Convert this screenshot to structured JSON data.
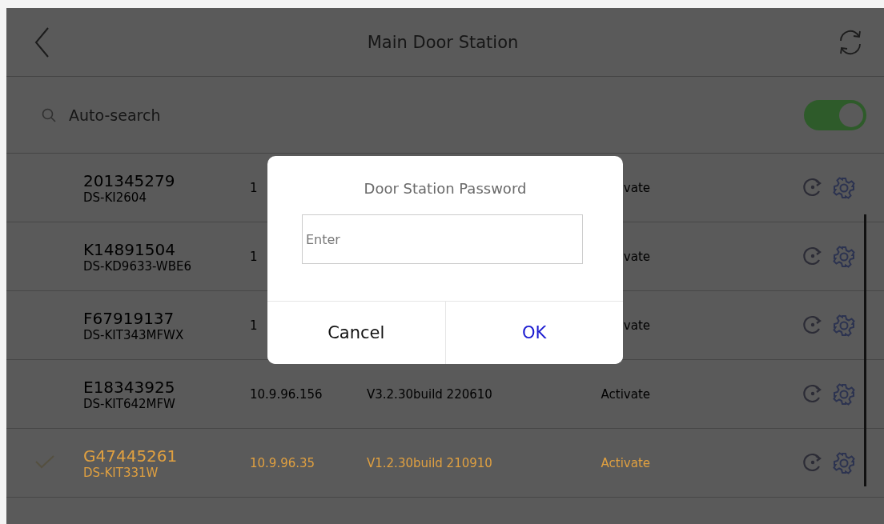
{
  "header": {
    "title": "Main Door Station"
  },
  "auto_search": {
    "label": "Auto-search",
    "on": true
  },
  "devices": [
    {
      "serial": "201345279",
      "model": "DS-KI2604",
      "ip": "1",
      "status": "vate",
      "selected": false
    },
    {
      "serial": "K14891504",
      "model": "DS-KD9633-WBE6",
      "ip": "1",
      "status": "vate",
      "selected": false
    },
    {
      "serial": "F67919137",
      "model": "DS-KIT343MFWX",
      "ip": "1",
      "status": "vate",
      "selected": false
    },
    {
      "serial": "E18343925",
      "model": "DS-KIT642MFW",
      "ip": "10.9.96.156",
      "firmware": "V3.2.30build 220610",
      "status": "Activate",
      "selected": false
    },
    {
      "serial": "G47445261",
      "model": "DS-KIT331W",
      "ip": "10.9.96.35",
      "firmware": "V1.2.30build 210910",
      "status": "Activate",
      "selected": true
    }
  ],
  "dialog": {
    "title": "Door Station Password",
    "field": {
      "placeholder": "Enter"
    },
    "buttons": [
      {
        "label": "Cancel",
        "kind": "cancel"
      },
      {
        "label": "OK",
        "kind": "confirm"
      }
    ]
  }
}
